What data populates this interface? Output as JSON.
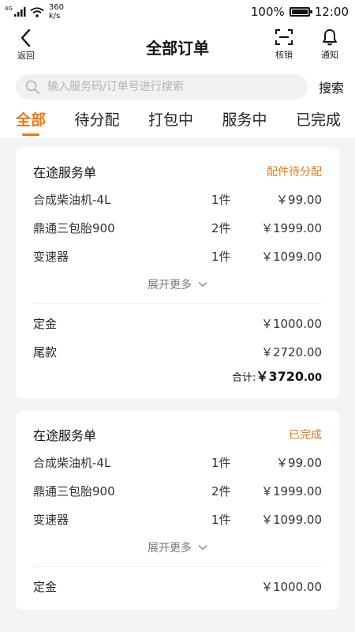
{
  "status_bar": {
    "network": "4G",
    "speed_value": "360",
    "speed_unit": "k/s",
    "battery": "100%",
    "battery_level": 1.0,
    "time": "12:00"
  },
  "header": {
    "back_label": "返回",
    "title": "全部订单",
    "scan_label": "核销",
    "notify_label": "通知"
  },
  "search": {
    "placeholder": "输入服务码/订单号进行搜索",
    "button": "搜索"
  },
  "tabs": [
    {
      "label": "全部",
      "active": true
    },
    {
      "label": "待分配",
      "active": false
    },
    {
      "label": "打包中",
      "active": false
    },
    {
      "label": "服务中",
      "active": false
    },
    {
      "label": "已完成",
      "active": false
    }
  ],
  "orders": [
    {
      "title": "在途服务单",
      "status": "配件待分配",
      "items": [
        {
          "name": "合成柴油机-4L",
          "qty": "1件",
          "price": "￥99.00"
        },
        {
          "name": "鼎通三包胎900",
          "qty": "2件",
          "price": "￥1999.00"
        },
        {
          "name": "变速器",
          "qty": "1件",
          "price": "￥1099.00"
        }
      ],
      "expand_label": "展开更多",
      "deposit_label": "定金",
      "deposit": "￥1000.00",
      "balance_label": "尾款",
      "balance": "￥2720.00",
      "total_label": "合计:",
      "total_currency": "￥",
      "total_int": "3720",
      "total_dec": ".00"
    },
    {
      "title": "在途服务单",
      "status": "已完成",
      "items": [
        {
          "name": "合成柴油机-4L",
          "qty": "1件",
          "price": "￥99.00"
        },
        {
          "name": "鼎通三包胎900",
          "qty": "2件",
          "price": "￥1999.00"
        },
        {
          "name": "变速器",
          "qty": "1件",
          "price": "￥1099.00"
        }
      ],
      "expand_label": "展开更多",
      "deposit_label": "定金",
      "deposit": "￥1000.00"
    }
  ],
  "colors": {
    "accent": "#e8781a",
    "background": "#f4f4f4"
  }
}
